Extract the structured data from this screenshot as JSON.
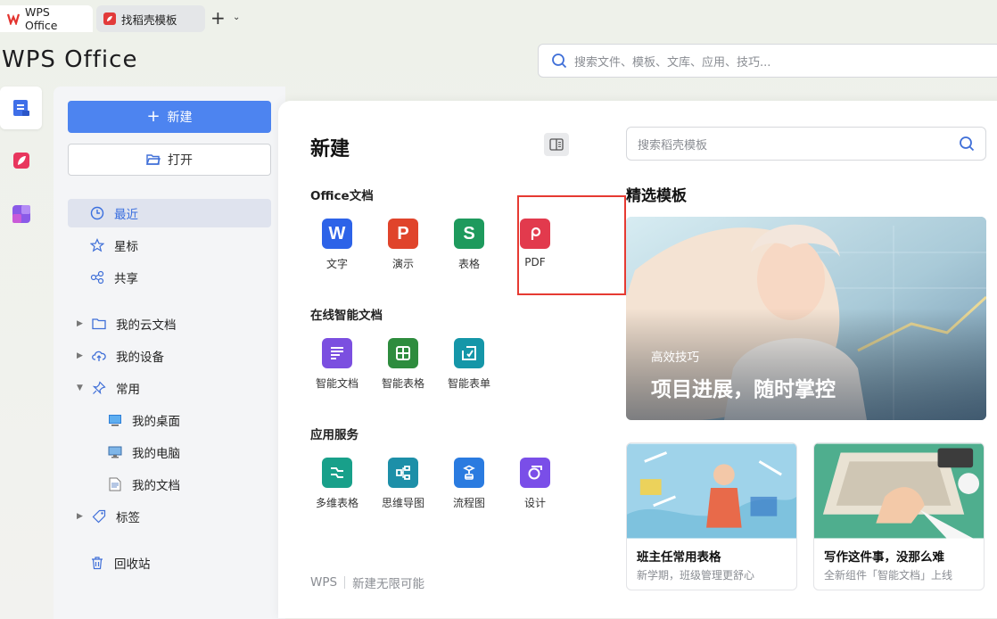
{
  "tabs": [
    {
      "label": "WPS Office"
    },
    {
      "label": "找稻壳模板"
    }
  ],
  "tab_add": "+",
  "tab_more": "⌄",
  "app_logo": "WPS Office",
  "global_search": {
    "placeholder": "搜索文件、模板、文库、应用、技巧..."
  },
  "sidebar": {
    "new_label": "新建",
    "open_label": "打开",
    "items": [
      {
        "label": "最近"
      },
      {
        "label": "星标"
      },
      {
        "label": "共享"
      },
      {
        "label": "我的云文档"
      },
      {
        "label": "我的设备"
      },
      {
        "label": "常用"
      },
      {
        "label": "我的桌面"
      },
      {
        "label": "我的电脑"
      },
      {
        "label": "我的文档"
      },
      {
        "label": "标签"
      },
      {
        "label": "回收站"
      }
    ]
  },
  "panel": {
    "title": "新建",
    "sections": [
      {
        "label": "Office文档",
        "apps": [
          {
            "label": "文字",
            "glyph": "W",
            "color": "#2d63e8"
          },
          {
            "label": "演示",
            "glyph": "P",
            "color": "#e0442b"
          },
          {
            "label": "表格",
            "glyph": "S",
            "color": "#1e9a5d"
          },
          {
            "label": "PDF",
            "glyph": "",
            "color": "#e23a4d"
          }
        ]
      },
      {
        "label": "在线智能文档",
        "apps": [
          {
            "label": "智能文档",
            "color": "#7b4fe0"
          },
          {
            "label": "智能表格",
            "color": "#2e8c3e"
          },
          {
            "label": "智能表单",
            "color": "#1596a8"
          }
        ]
      },
      {
        "label": "应用服务",
        "apps": [
          {
            "label": "多维表格",
            "color": "#18a08a"
          },
          {
            "label": "思维导图",
            "color": "#1d8fa8"
          },
          {
            "label": "流程图",
            "color": "#2a7be0"
          },
          {
            "label": "设计",
            "color": "#7a4ee8"
          }
        ]
      }
    ],
    "footer_brand": "WPS",
    "footer_slogan": "新建无限可能"
  },
  "templates": {
    "search_placeholder": "搜索稻壳模板",
    "title": "精选模板",
    "banner": {
      "subtitle": "高效技巧",
      "title": "项目进展，随时掌控"
    },
    "cards": [
      {
        "title": "班主任常用表格",
        "subtitle": "新学期，班级管理更舒心"
      },
      {
        "title": "写作这件事，没那么难",
        "subtitle": "全新组件「智能文档」上线"
      }
    ]
  },
  "colors": {
    "accent": "#4d84f0",
    "highlight_box": "#e63a32"
  }
}
